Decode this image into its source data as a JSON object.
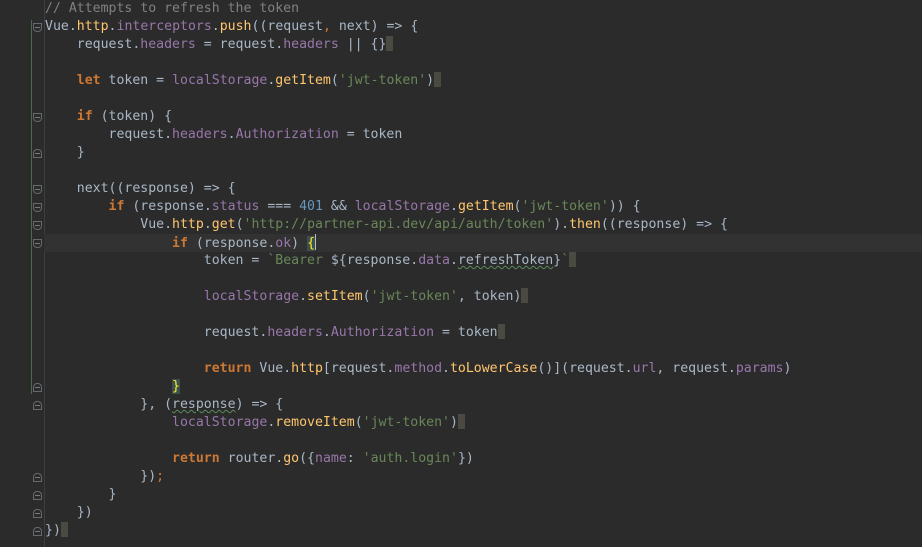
{
  "editor": {
    "lines": [
      [
        {
          "t": "// Attempts to refresh the token",
          "c": "c"
        }
      ],
      [
        {
          "t": "Vue",
          "c": "t"
        },
        {
          "t": ".",
          "c": "t"
        },
        {
          "t": "http",
          "c": "f"
        },
        {
          "t": ".",
          "c": "t"
        },
        {
          "t": "interceptors",
          "c": "p"
        },
        {
          "t": ".",
          "c": "t"
        },
        {
          "t": "push",
          "c": "f"
        },
        {
          "t": "((request",
          "c": "t"
        },
        {
          "t": ", ",
          "c": "op"
        },
        {
          "t": "next) => {",
          "c": "t"
        }
      ],
      [
        {
          "t": "    request.",
          "c": "t"
        },
        {
          "t": "headers",
          "c": "p"
        },
        {
          "t": " = request.",
          "c": "t"
        },
        {
          "t": "headers",
          "c": "p"
        },
        {
          "t": " || {}",
          "c": "t"
        },
        {
          "t": "",
          "c": "pm"
        }
      ],
      [],
      [
        {
          "t": "    ",
          "c": "t"
        },
        {
          "t": "let",
          "c": "k"
        },
        {
          "t": " token = ",
          "c": "t"
        },
        {
          "t": "localStorage",
          "c": "p"
        },
        {
          "t": ".",
          "c": "t"
        },
        {
          "t": "getItem",
          "c": "f"
        },
        {
          "t": "(",
          "c": "t"
        },
        {
          "t": "'jwt-token'",
          "c": "s"
        },
        {
          "t": ")",
          "c": "t"
        },
        {
          "t": "",
          "c": "pm"
        }
      ],
      [],
      [
        {
          "t": "    ",
          "c": "t"
        },
        {
          "t": "if",
          "c": "k"
        },
        {
          "t": " (token) {",
          "c": "t"
        }
      ],
      [
        {
          "t": "        request.",
          "c": "t"
        },
        {
          "t": "headers",
          "c": "p"
        },
        {
          "t": ".",
          "c": "t"
        },
        {
          "t": "Authorization",
          "c": "p"
        },
        {
          "t": " = token",
          "c": "t"
        }
      ],
      [
        {
          "t": "    }",
          "c": "t"
        }
      ],
      [],
      [
        {
          "t": "    next((response) => {",
          "c": "t"
        }
      ],
      [
        {
          "t": "        ",
          "c": "t"
        },
        {
          "t": "if",
          "c": "k"
        },
        {
          "t": " (response.",
          "c": "t"
        },
        {
          "t": "status",
          "c": "p"
        },
        {
          "t": " === ",
          "c": "t"
        },
        {
          "t": "401",
          "c": "n"
        },
        {
          "t": " && ",
          "c": "t"
        },
        {
          "t": "localStorage",
          "c": "p"
        },
        {
          "t": ".",
          "c": "t"
        },
        {
          "t": "getItem",
          "c": "f"
        },
        {
          "t": "(",
          "c": "t"
        },
        {
          "t": "'jwt-token'",
          "c": "s"
        },
        {
          "t": ")) {",
          "c": "t"
        }
      ],
      [
        {
          "t": "            Vue.",
          "c": "t"
        },
        {
          "t": "http",
          "c": "f"
        },
        {
          "t": ".",
          "c": "t"
        },
        {
          "t": "get",
          "c": "f"
        },
        {
          "t": "(",
          "c": "t"
        },
        {
          "t": "'http://partner-api.dev/api/auth/token'",
          "c": "s"
        },
        {
          "t": ").",
          "c": "t"
        },
        {
          "t": "then",
          "c": "f"
        },
        {
          "t": "((response) => {",
          "c": "t"
        }
      ],
      [
        {
          "t": "                ",
          "c": "t"
        },
        {
          "t": "if",
          "c": "k"
        },
        {
          "t": " (response.",
          "c": "t"
        },
        {
          "t": "ok",
          "c": "p"
        },
        {
          "t": ") ",
          "c": "t"
        },
        {
          "t": "{",
          "c": "hl"
        },
        {
          "t": "",
          "c": "caret"
        }
      ],
      [
        {
          "t": "                    token = ",
          "c": "t"
        },
        {
          "t": "`Bearer ",
          "c": "s"
        },
        {
          "t": "${response.",
          "c": "t"
        },
        {
          "t": "data",
          "c": "p"
        },
        {
          "t": ".",
          "c": "t"
        },
        {
          "t": "refreshToken",
          "c": "sq"
        },
        {
          "t": "}",
          "c": "t"
        },
        {
          "t": "`",
          "c": "s"
        },
        {
          "t": "",
          "c": "pm"
        }
      ],
      [],
      [
        {
          "t": "                    ",
          "c": "t"
        },
        {
          "t": "localStorage",
          "c": "p"
        },
        {
          "t": ".",
          "c": "t"
        },
        {
          "t": "setItem",
          "c": "f"
        },
        {
          "t": "(",
          "c": "t"
        },
        {
          "t": "'jwt-token'",
          "c": "s"
        },
        {
          "t": ", token)",
          "c": "t"
        },
        {
          "t": "",
          "c": "pm"
        }
      ],
      [],
      [
        {
          "t": "                    request.",
          "c": "t"
        },
        {
          "t": "headers",
          "c": "p"
        },
        {
          "t": ".",
          "c": "t"
        },
        {
          "t": "Authorization",
          "c": "p"
        },
        {
          "t": " = token",
          "c": "t"
        },
        {
          "t": "",
          "c": "pm"
        }
      ],
      [],
      [
        {
          "t": "                    ",
          "c": "t"
        },
        {
          "t": "return",
          "c": "k"
        },
        {
          "t": " Vue.",
          "c": "t"
        },
        {
          "t": "http",
          "c": "f"
        },
        {
          "t": "[request.",
          "c": "t"
        },
        {
          "t": "method",
          "c": "p"
        },
        {
          "t": ".",
          "c": "t"
        },
        {
          "t": "toLowerCase",
          "c": "f"
        },
        {
          "t": "()](request.",
          "c": "t"
        },
        {
          "t": "url",
          "c": "p"
        },
        {
          "t": ", request.",
          "c": "t"
        },
        {
          "t": "params",
          "c": "p"
        },
        {
          "t": ")",
          "c": "t"
        }
      ],
      [
        {
          "t": "                ",
          "c": "t"
        },
        {
          "t": "}",
          "c": "hl"
        }
      ],
      [
        {
          "t": "            }, (",
          "c": "t"
        },
        {
          "t": "response",
          "c": "sq"
        },
        {
          "t": ") => {",
          "c": "t"
        }
      ],
      [
        {
          "t": "                ",
          "c": "t"
        },
        {
          "t": "localStorage",
          "c": "p"
        },
        {
          "t": ".",
          "c": "t"
        },
        {
          "t": "removeItem",
          "c": "f"
        },
        {
          "t": "(",
          "c": "t"
        },
        {
          "t": "'jwt-token'",
          "c": "s"
        },
        {
          "t": ")",
          "c": "t"
        },
        {
          "t": "",
          "c": "pm"
        }
      ],
      [],
      [
        {
          "t": "                ",
          "c": "t"
        },
        {
          "t": "return",
          "c": "k"
        },
        {
          "t": " router.",
          "c": "t"
        },
        {
          "t": "go",
          "c": "f"
        },
        {
          "t": "({",
          "c": "t"
        },
        {
          "t": "name",
          "c": "p"
        },
        {
          "t": ": ",
          "c": "t"
        },
        {
          "t": "'auth.login'",
          "c": "s"
        },
        {
          "t": "})",
          "c": "t"
        }
      ],
      [
        {
          "t": "            })",
          "c": "t"
        },
        {
          "t": ";",
          "c": "op"
        }
      ],
      [
        {
          "t": "        }",
          "c": "t"
        }
      ],
      [
        {
          "t": "    })",
          "c": "t"
        }
      ],
      [
        {
          "t": "})",
          "c": "t"
        },
        {
          "t": "",
          "c": "pm"
        }
      ]
    ],
    "folds": [
      {
        "line": 1,
        "kind": "open"
      },
      {
        "line": 6,
        "kind": "open"
      },
      {
        "line": 8,
        "kind": "close"
      },
      {
        "line": 10,
        "kind": "open"
      },
      {
        "line": 11,
        "kind": "open"
      },
      {
        "line": 12,
        "kind": "open"
      },
      {
        "line": 13,
        "kind": "open"
      },
      {
        "line": 21,
        "kind": "close"
      },
      {
        "line": 22,
        "kind": "close"
      },
      {
        "line": 26,
        "kind": "close"
      },
      {
        "line": 27,
        "kind": "close"
      },
      {
        "line": 28,
        "kind": "close"
      },
      {
        "line": 29,
        "kind": "close"
      }
    ],
    "current_line": 13,
    "intention_icon": "lightbulb-icon"
  }
}
